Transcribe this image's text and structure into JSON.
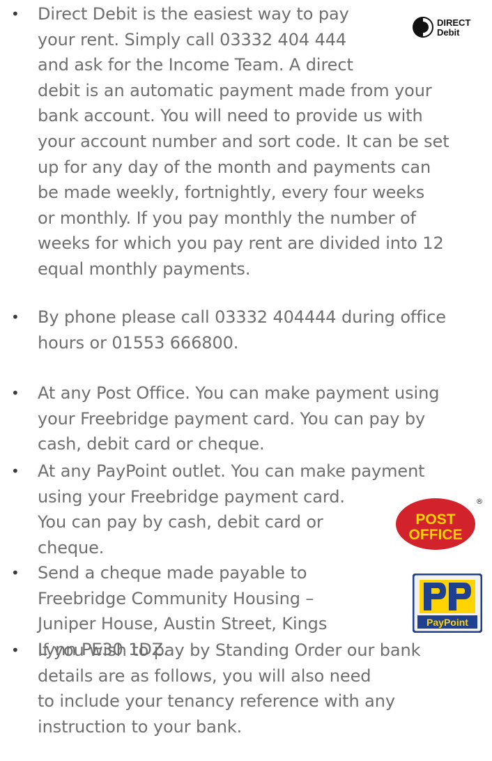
{
  "items": [
    {
      "lines": [
        "Direct Debit is the easiest way to pay",
        "your rent. Simply call 03332 404 444",
        "and ask for the Income Team. A direct",
        "debit is an automatic payment made from your",
        "bank account. You will need to provide us with",
        "your account number and sort code. It can be set",
        "up for any day of the month and payments can",
        "be made weekly, fortnightly, every four weeks",
        "or monthly. If you pay monthly the number of",
        "weeks for which you pay rent are divided into 12",
        "equal monthly payments."
      ]
    },
    {
      "lines": [
        "By phone please call 03332 404444 during office",
        "hours or 01553 666800."
      ]
    },
    {
      "lines": [
        "At any Post Office. You can make payment using",
        "your Freebridge payment card. You can pay by",
        "cash, debit card or cheque."
      ]
    },
    {
      "lines": [
        "At any PayPoint outlet. You can make payment",
        "using your Freebridge payment card.",
        "You can pay by cash, debit card or",
        "cheque."
      ]
    },
    {
      "lines": [
        "Send a cheque made payable to",
        "Freebridge Community Housing –",
        "Juniper House, Austin Street, Kings",
        "Lynn PE30 1DZ."
      ]
    },
    {
      "lines": [
        "If you wish to pay by Standing Order our bank",
        "details are as follows, you will also need",
        "to include your tenancy reference with any",
        "instruction to your bank."
      ]
    }
  ],
  "bullet_symbol": "•",
  "logos": {
    "direct_debit": {
      "line1": "DIRECT",
      "line2": "Debit"
    },
    "post_office": {
      "line1": "POST",
      "line2": "OFFICE",
      "mark": "®"
    },
    "paypoint": {
      "label": "PayPoint"
    }
  },
  "colors": {
    "text": "#6e6e6e",
    "post_office_red": "#d2222b",
    "post_office_yellow": "#ffd200",
    "paypoint_blue": "#1f3f8f",
    "paypoint_yellow": "#ffd400"
  }
}
